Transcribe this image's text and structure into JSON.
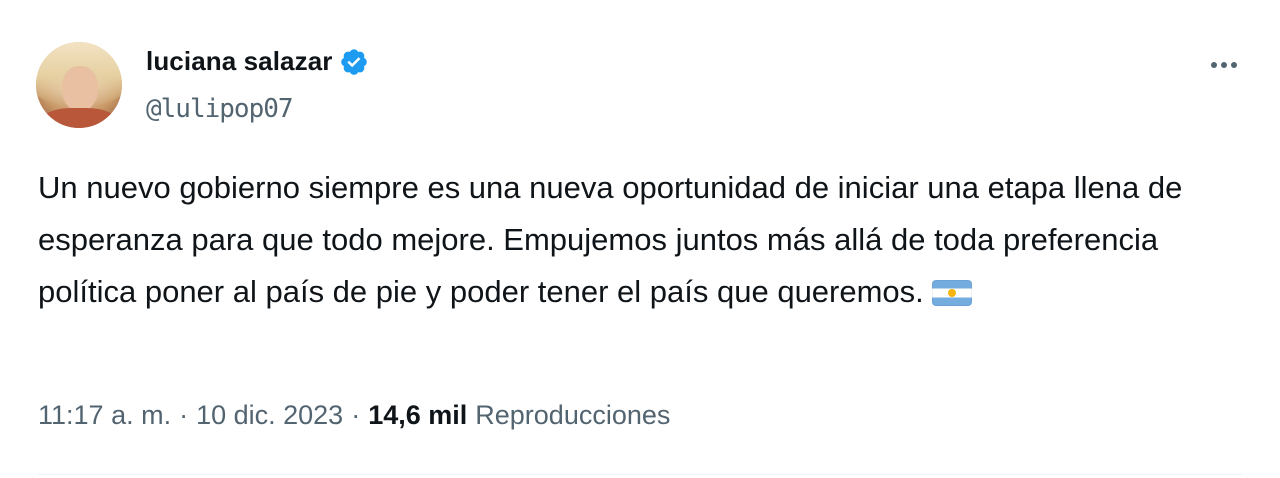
{
  "author": {
    "display_name": "luciana salazar",
    "handle": "@lulipop07",
    "verified": true,
    "verified_color": "#1d9bf0"
  },
  "tweet": {
    "text": "Un nuevo gobierno siempre es una nueva oportunidad de iniciar una etapa llena de esperanza para que todo mejore. Empujemos juntos más allá de toda preferencia política poner al país de pie y poder tener el país que queremos.",
    "emoji": "argentina-flag"
  },
  "meta": {
    "time": "11:17 a. m.",
    "separator": "·",
    "date": "10 dic. 2023",
    "views_count": "14,6 mil",
    "views_label": "Reproducciones"
  },
  "actions": {
    "more_icon": "more-horizontal-icon"
  },
  "colors": {
    "text_primary": "#0f1419",
    "text_secondary": "#536471",
    "divider": "#eff3f4"
  }
}
